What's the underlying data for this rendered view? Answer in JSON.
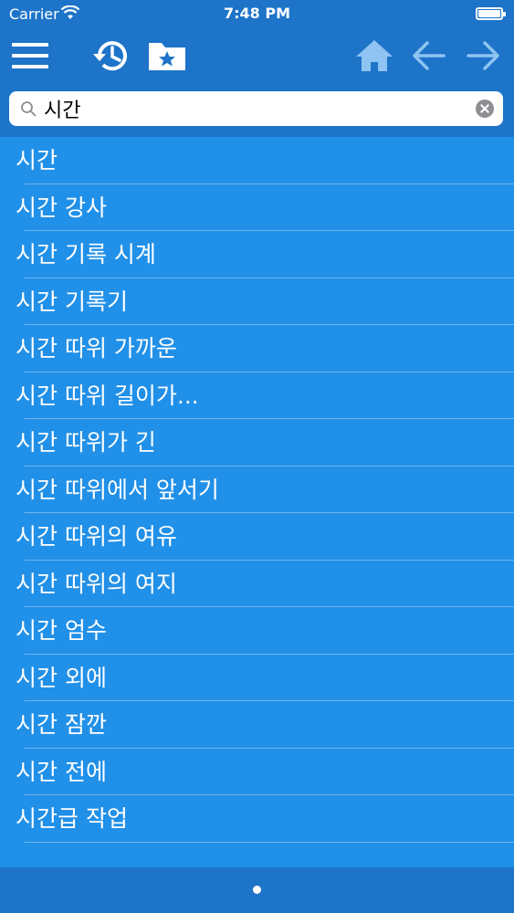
{
  "status_bar": {
    "carrier": "Carrier",
    "time": "7:48 PM"
  },
  "toolbar": {
    "icons": [
      "menu-icon",
      "history-icon",
      "favorites-folder-icon",
      "home-icon",
      "back-arrow-icon",
      "forward-arrow-icon"
    ],
    "accent_color": "#1d74c9",
    "disabled_icon_color": "#8fc4f2"
  },
  "search": {
    "value": "시간"
  },
  "results": [
    "시간",
    "시간 강사",
    "시간 기록 시계",
    "시간 기록기",
    "시간 따위 가까운",
    "시간 따위 길이가...",
    "시간 따위가 긴",
    "시간 따위에서 앞서기",
    "시간 따위의 여유",
    "시간 따위의 여지",
    "시간 엄수",
    "시간 외에",
    "시간 잠깐",
    "시간 전에",
    "시간급 작업"
  ],
  "colors": {
    "list_background": "#2190e8",
    "header_background": "#1d74c9"
  },
  "pager": {
    "pages": 1,
    "current": 1
  }
}
